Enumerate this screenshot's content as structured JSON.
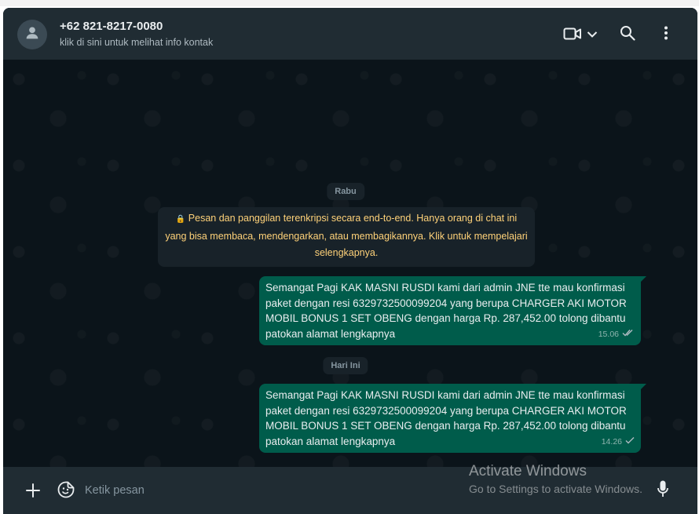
{
  "header": {
    "contact_name": "+62 821-8217-0080",
    "contact_subtitle": "klik di sini untuk melihat info kontak",
    "icons": [
      "video-call-icon",
      "chevron-down-icon",
      "search-icon",
      "menu-icon",
      "avatar-icon"
    ]
  },
  "chat": {
    "day_label_1": "Rabu",
    "encryption_notice": "Pesan dan panggilan terenkripsi secara end-to-end. Hanya orang di chat ini yang bisa membaca, mendengarkan, atau membagikannya. Klik untuk mempelajari selengkapnya.",
    "day_label_2": "Hari Ini",
    "messages": [
      {
        "text": "Semangat Pagi KAK MASNI RUSDI kami dari admin JNE tte mau konfirmasi paket dengan resi 6329732500099204 yang berupa CHARGER AKI MOTOR MOBIL BONUS 1 SET OBENG dengan harga Rp. 287,452.00 tolong dibantu patokan alamat lengkapnya",
        "time": "15.06",
        "status": "read-double-check"
      },
      {
        "text": "Semangat Pagi KAK MASNI RUSDI kami dari admin JNE tte mau konfirmasi paket dengan resi 6329732500099204 yang berupa CHARGER AKI MOTOR MOBIL BONUS 1 SET OBENG dengan harga Rp. 287,452.00 tolong dibantu patokan alamat lengkapnya",
        "time": "14.26",
        "status": "sent-single-check"
      }
    ]
  },
  "footer": {
    "input_placeholder": "Ketik pesan",
    "icons": [
      "plus-icon",
      "sticker-emoji-icon",
      "microphone-icon"
    ]
  },
  "watermark": {
    "title": "Activate Windows",
    "subtitle": "Go to Settings to activate Windows."
  },
  "colors": {
    "header_bg": "#202c33",
    "chat_bg": "#0b141a",
    "outgoing_bubble": "#005c4b",
    "notice_text": "#ffd279"
  }
}
